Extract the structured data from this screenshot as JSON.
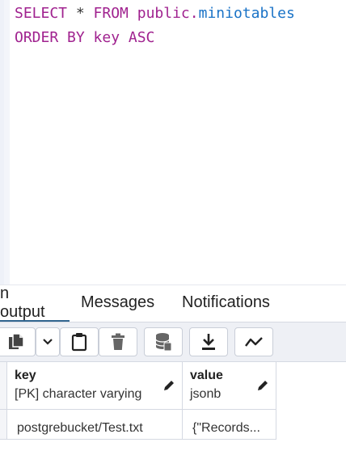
{
  "editor": {
    "line1": {
      "kw1": "SELECT",
      "op": " * ",
      "kw2": "FROM",
      "schema": " public.",
      "table": "miniotables"
    },
    "line2": {
      "kw": "ORDER BY",
      "rest": " key ASC"
    }
  },
  "tabs": [
    {
      "label": "n output",
      "active": true
    },
    {
      "label": "Messages",
      "active": false
    },
    {
      "label": "Notifications",
      "active": false
    }
  ],
  "toolbar": {
    "icons": [
      "copy-icon",
      "dropdown-chevron-icon",
      "paste-icon",
      "delete-icon",
      "save-data-icon",
      "download-icon",
      "graph-visualiser-icon"
    ]
  },
  "grid": {
    "columns": [
      {
        "name": "key",
        "type": "[PK] character varying"
      },
      {
        "name": "value",
        "type": "jsonb"
      }
    ],
    "rows": [
      [
        "postgrebucket/Test.txt",
        "{\"Records..."
      ]
    ]
  },
  "colors": {
    "keyword": "#a0228f",
    "identifier": "#1a73c7",
    "active_tab": "#326690"
  }
}
